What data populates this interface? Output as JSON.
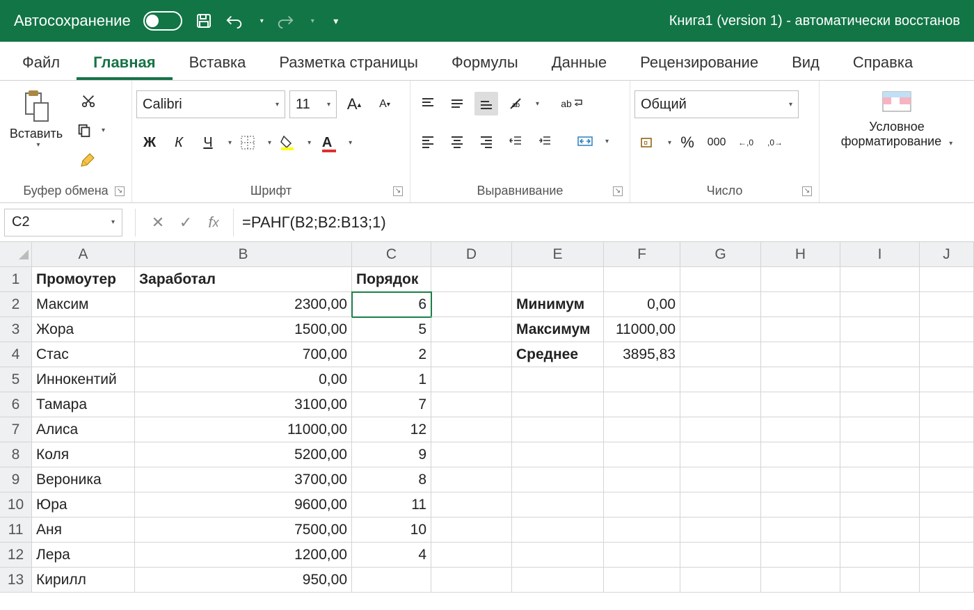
{
  "titlebar": {
    "autosave_label": "Автосохранение",
    "title": "Книга1 (version 1)  -  автоматически восстанов"
  },
  "tabs": {
    "file": "Файл",
    "home": "Главная",
    "insert": "Вставка",
    "layout": "Разметка страницы",
    "formulas": "Формулы",
    "data": "Данные",
    "review": "Рецензирование",
    "view": "Вид",
    "help": "Справка"
  },
  "ribbon": {
    "paste_label": "Вставить",
    "clipboard_group": "Буфер обмена",
    "font_name": "Calibri",
    "font_size": "11",
    "font_group": "Шрифт",
    "align_group": "Выравнивание",
    "number_format": "Общий",
    "number_group": "Число",
    "cond_fmt_line1": "Условное",
    "cond_fmt_line2": "форматирование",
    "bold": "Ж",
    "italic": "К",
    "underline": "Ч",
    "font_big_A": "A",
    "font_small_A": "A",
    "wrap_text": "ab",
    "percent": "%",
    "thousand": "000",
    "dec_inc": ",00",
    "dec_dec": ",00"
  },
  "formula_bar": {
    "cell_ref": "C2",
    "formula": "=РАНГ(B2;B2:B13;1)"
  },
  "columns": [
    "A",
    "B",
    "C",
    "D",
    "E",
    "F",
    "G",
    "H",
    "I",
    "J"
  ],
  "headers": {
    "A": "Промоутер",
    "B": "Заработал",
    "C": "Порядок"
  },
  "rows": [
    {
      "n": "2",
      "A": "Максим",
      "B": "2300,00",
      "C": "6",
      "E": "Минимум",
      "F": "0,00"
    },
    {
      "n": "3",
      "A": "Жора",
      "B": "1500,00",
      "C": "5",
      "E": "Максимум",
      "F": "11000,00"
    },
    {
      "n": "4",
      "A": "Стас",
      "B": "700,00",
      "C": "2",
      "E": "Среднее",
      "F": "3895,83"
    },
    {
      "n": "5",
      "A": "Иннокентий",
      "B": "0,00",
      "C": "1"
    },
    {
      "n": "6",
      "A": "Тамара",
      "B": "3100,00",
      "C": "7"
    },
    {
      "n": "7",
      "A": "Алиса",
      "B": "11000,00",
      "C": "12"
    },
    {
      "n": "8",
      "A": "Коля",
      "B": "5200,00",
      "C": "9"
    },
    {
      "n": "9",
      "A": "Вероника",
      "B": "3700,00",
      "C": "8"
    },
    {
      "n": "10",
      "A": "Юра",
      "B": "9600,00",
      "C": "11"
    },
    {
      "n": "11",
      "A": "Аня",
      "B": "7500,00",
      "C": "10"
    },
    {
      "n": "12",
      "A": "Лера",
      "B": "1200,00",
      "C": "4"
    },
    {
      "n": "13",
      "A": "Кирилл",
      "B": "950,00",
      "C": ""
    }
  ]
}
